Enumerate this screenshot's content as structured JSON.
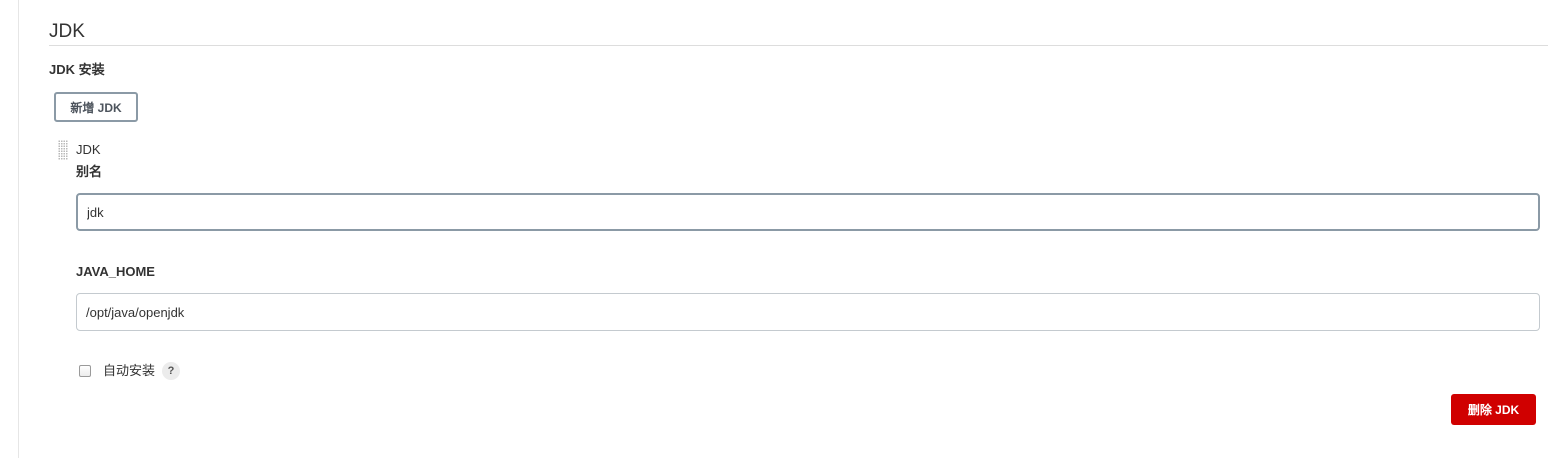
{
  "section": {
    "title": "JDK",
    "subtitle": "JDK 安装"
  },
  "add_button": {
    "label": "新增 JDK"
  },
  "item": {
    "header": "JDK",
    "alias_label": "别名",
    "alias_value": "jdk",
    "java_home_label": "JAVA_HOME",
    "java_home_value": "/opt/java/openjdk",
    "auto_install_label": "自动安装",
    "auto_install_checked": false,
    "help_glyph": "?",
    "delete_label": "删除 JDK"
  },
  "colors": {
    "delete_button": "#d00000",
    "button_border": "#8b9aa6"
  },
  "icons": {
    "drag": "drag-handle-icon",
    "help": "help-icon"
  }
}
